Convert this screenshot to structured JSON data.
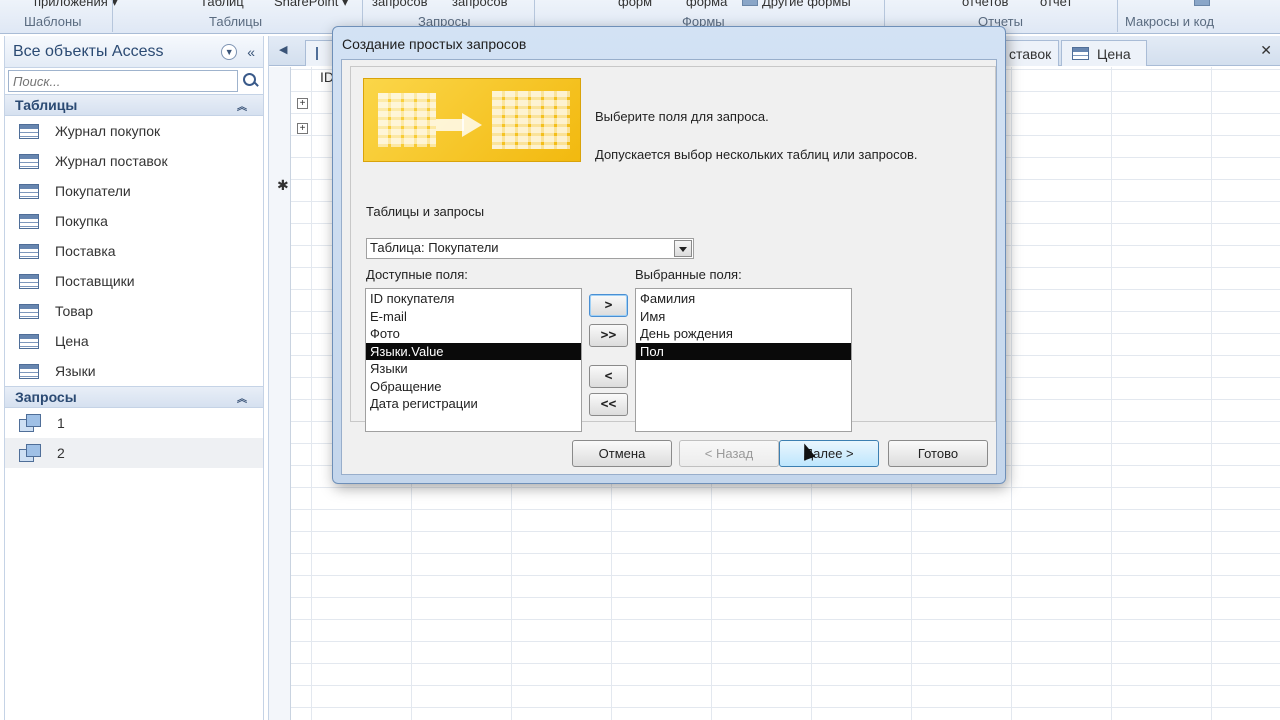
{
  "ribbon": {
    "top_labels": [
      "приложения ▾",
      "Таблиц",
      "SharePoint ▾",
      "запросов",
      "запросов",
      "форм",
      "форма",
      "Другие формы",
      "отчетов",
      "отчет"
    ],
    "groups": [
      "Шаблоны",
      "Таблицы",
      "Запросы",
      "Формы",
      "Отчеты",
      "Макросы и код"
    ]
  },
  "nav": {
    "title": "Все объекты Access",
    "search_placeholder": "Поиск...",
    "tables_header": "Таблицы",
    "tables": [
      "Журнал покупок",
      "Журнал поставок",
      "Покупатели",
      "Покупка",
      "Поставка",
      "Поставщики",
      "Товар",
      "Цена",
      "Языки"
    ],
    "queries_header": "Запросы",
    "queries": [
      "1",
      "2"
    ]
  },
  "doc": {
    "tabs": [
      "ставок",
      "Цена"
    ],
    "column_header": "ID"
  },
  "dialog": {
    "title": "Создание простых запросов",
    "intro_line1": "Выберите поля для запроса.",
    "intro_line2": "Допускается выбор нескольких таблиц или запросов.",
    "tables_label": "Таблицы и запросы",
    "combo_value": "Таблица: Покупатели",
    "available_label": "Доступные поля:",
    "selected_label": "Выбранные поля:",
    "available_fields": [
      "ID покупателя",
      "E-mail",
      "Фото",
      "Языки.Value",
      "Языки",
      "Обращение",
      "Дата регистрации"
    ],
    "available_selected_index": 3,
    "selected_fields": [
      "Фамилия",
      "Имя",
      "День рождения",
      "Пол"
    ],
    "selected_selected_index": 3,
    "move_buttons": [
      ">",
      ">>",
      "<",
      "<<"
    ],
    "buttons": {
      "cancel": "Отмена",
      "back": "< Назад",
      "next": "Далее >",
      "finish": "Готово"
    }
  }
}
